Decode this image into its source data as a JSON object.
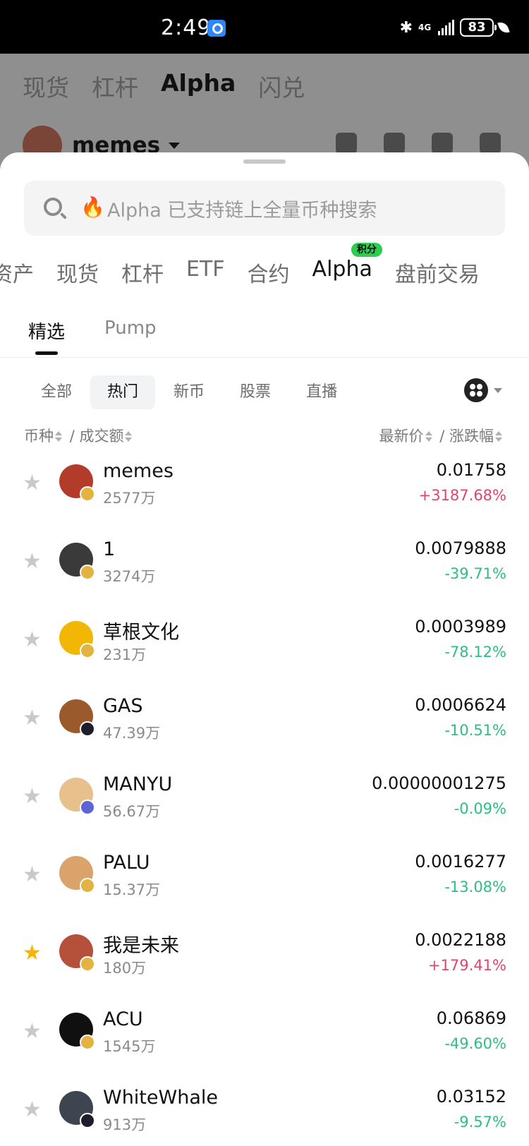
{
  "status_bar": {
    "time": "2:49",
    "network": "4G",
    "battery": "83"
  },
  "background_page": {
    "tabs": [
      "现货",
      "杠杆",
      "Alpha",
      "闪兑"
    ],
    "active_tab": 2,
    "token_title": "memes"
  },
  "sheet": {
    "search_placeholder": "Alpha 已支持链上全量币种搜索",
    "category_tabs": [
      "资产",
      "现货",
      "杠杆",
      "ETF",
      "合约",
      "Alpha",
      "盘前交易"
    ],
    "alpha_badge": "积分",
    "sub_tabs": [
      "精选",
      "Pump"
    ],
    "filters": [
      "全部",
      "热门",
      "新币",
      "股票",
      "直播"
    ],
    "headers": {
      "coin": "币种",
      "volume": "成交额",
      "price": "最新价",
      "change": "涨跌幅",
      "sep": "/"
    },
    "rows": [
      {
        "name": "memes",
        "volume": "2577万",
        "price": "0.01758",
        "change": "+3187.68%",
        "dir": "up",
        "starred": false,
        "chain": "bsc",
        "avatar_color": "#b33b2a"
      },
      {
        "name": "1",
        "volume": "3274万",
        "price": "0.0079888",
        "change": "-39.71%",
        "dir": "down",
        "starred": false,
        "chain": "bsc",
        "avatar_color": "#3a3a3a"
      },
      {
        "name": "草根文化",
        "volume": "231万",
        "price": "0.0003989",
        "change": "-78.12%",
        "dir": "down",
        "starred": false,
        "chain": "bsc",
        "avatar_color": "#f2b705"
      },
      {
        "name": "GAS",
        "volume": "47.39万",
        "price": "0.0006624",
        "change": "-10.51%",
        "dir": "down",
        "starred": false,
        "chain": "sol",
        "avatar_color": "#9a5a2c"
      },
      {
        "name": "MANYU",
        "volume": "56.67万",
        "price": "0.00000001275",
        "change": "-0.09%",
        "dir": "down",
        "starred": false,
        "chain": "eth",
        "avatar_color": "#e7c08c"
      },
      {
        "name": "PALU",
        "volume": "15.37万",
        "price": "0.0016277",
        "change": "-13.08%",
        "dir": "down",
        "starred": false,
        "chain": "bsc",
        "avatar_color": "#d9a36b"
      },
      {
        "name": "我是未来",
        "volume": "180万",
        "price": "0.0022188",
        "change": "+179.41%",
        "dir": "up",
        "starred": true,
        "chain": "bsc",
        "avatar_color": "#b5513b"
      },
      {
        "name": "ACU",
        "volume": "1545万",
        "price": "0.06869",
        "change": "-49.60%",
        "dir": "down",
        "starred": false,
        "chain": "bsc",
        "avatar_color": "#101010"
      },
      {
        "name": "WhiteWhale",
        "volume": "913万",
        "price": "0.03152",
        "change": "-9.57%",
        "dir": "down",
        "starred": false,
        "chain": "sol",
        "avatar_color": "#3d4650"
      }
    ]
  }
}
